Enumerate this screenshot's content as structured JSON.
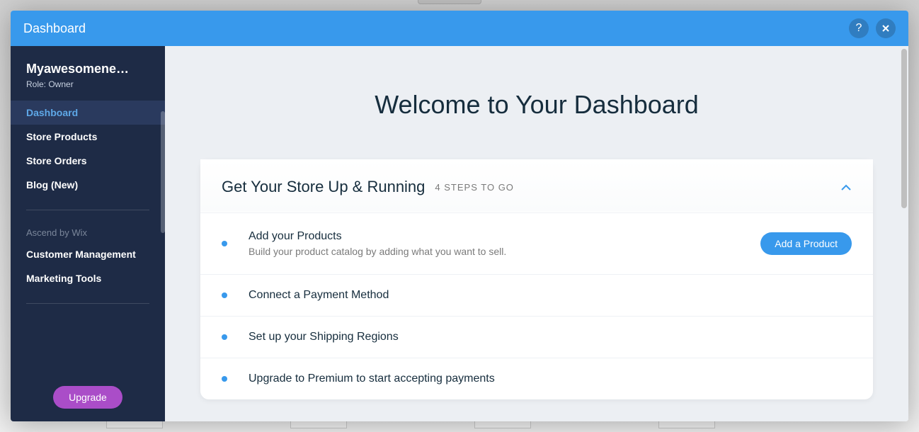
{
  "header": {
    "title": "Dashboard"
  },
  "sidebar": {
    "site_name": "Myawesomene…",
    "role_label": "Role: Owner",
    "nav": [
      {
        "label": "Dashboard",
        "active": true
      },
      {
        "label": "Store Products",
        "active": false
      },
      {
        "label": "Store Orders",
        "active": false
      },
      {
        "label": "Blog (New)",
        "active": false
      }
    ],
    "ascend_label": "Ascend by Wix",
    "ascend_nav": [
      {
        "label": "Customer Management"
      },
      {
        "label": "Marketing Tools"
      }
    ],
    "upgrade_label": "Upgrade"
  },
  "main": {
    "welcome": "Welcome to Your Dashboard",
    "setup": {
      "title": "Get Your Store Up & Running",
      "steps_label": "4 STEPS TO GO",
      "steps": [
        {
          "title": "Add your Products",
          "desc": "Build your product catalog by adding what you want to sell.",
          "cta": "Add a Product"
        },
        {
          "title": "Connect a Payment Method",
          "desc": "",
          "cta": ""
        },
        {
          "title": "Set up your Shipping Regions",
          "desc": "",
          "cta": ""
        },
        {
          "title": "Upgrade to Premium to start accepting payments",
          "desc": "",
          "cta": ""
        }
      ]
    }
  }
}
